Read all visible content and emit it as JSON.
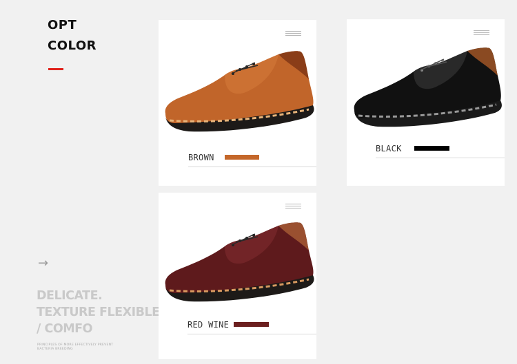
{
  "heading": {
    "line1": "OPT",
    "line2": "COLOR"
  },
  "accent": "#e0231c",
  "tagline": {
    "line1": "DELICATE.",
    "line2": "TEXTURE FLEXIBLE",
    "line3": "/ COMFO"
  },
  "small_print": {
    "line1": "PRINCIPLES OF MORE EFFECTIVELY PREVENT",
    "line2": "BACTERIA BREEDING"
  },
  "arrow_icon": "right-arrow-icon",
  "cards": [
    {
      "label": "BROWN",
      "swatch_color": "#c4672a",
      "icon": "menu-icon"
    },
    {
      "label": "BLACK",
      "swatch_color": "#000000",
      "icon": "menu-icon"
    },
    {
      "label": "RED WINE",
      "swatch_color": "#6b1f1f",
      "icon": "menu-icon"
    }
  ]
}
